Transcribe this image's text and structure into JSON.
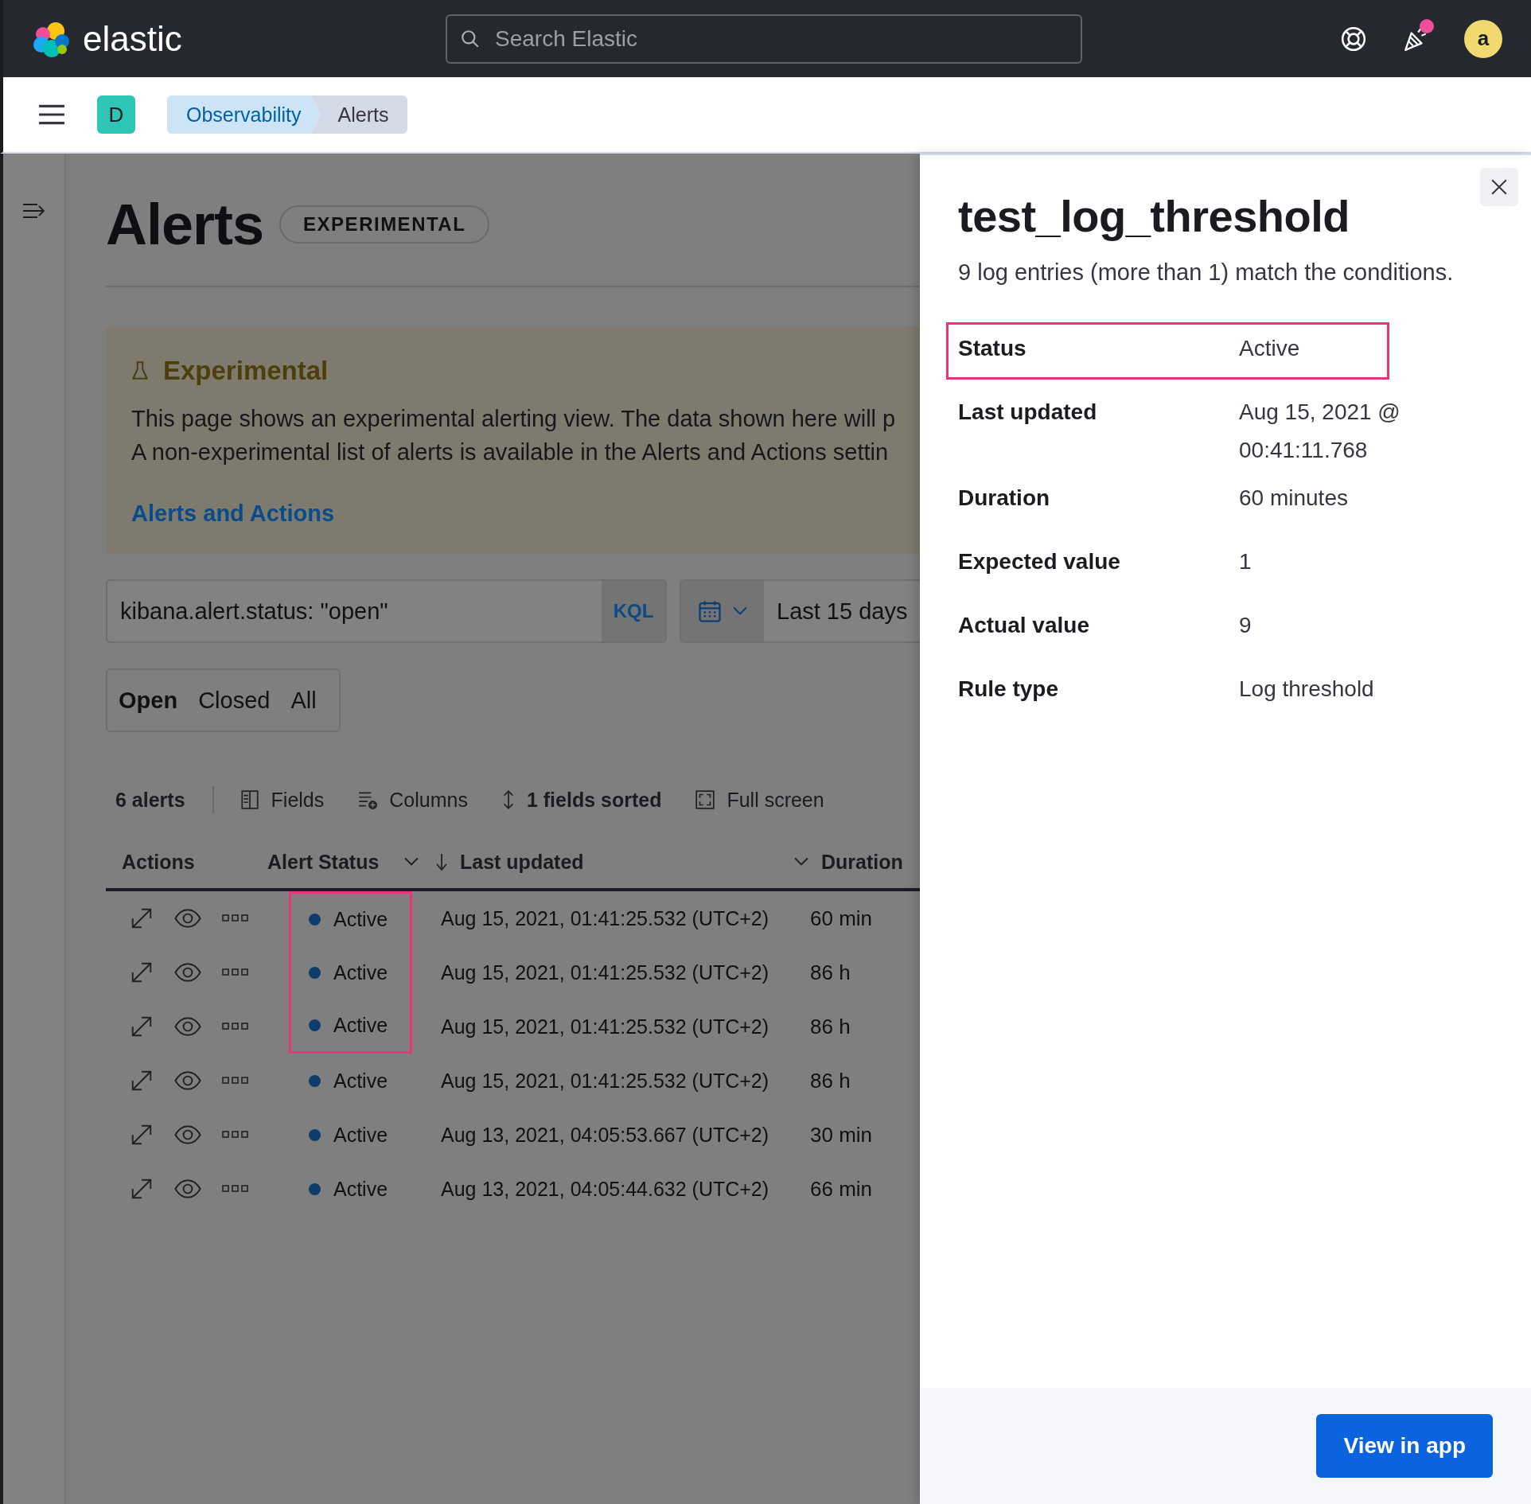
{
  "header": {
    "logo": "elastic",
    "search": {
      "placeholder": "Search Elastic"
    },
    "has_notification": true,
    "avatar": "a"
  },
  "breadcrumb_bar": {
    "space": "D",
    "crumbs": [
      {
        "label": "Observability",
        "selected": false
      },
      {
        "label": "Alerts",
        "selected": true
      }
    ]
  },
  "page": {
    "title": "Alerts",
    "badge": "EXPERIMENTAL",
    "callout": {
      "title": "Experimental",
      "lines": [
        "This page shows an experimental alerting view. The data shown here will p",
        "A non-experimental list of alerts is available in the Alerts and Actions settin"
      ],
      "link": "Alerts and Actions"
    },
    "query": {
      "value": "kibana.alert.status: \"open\"",
      "language": "KQL"
    },
    "date_range": "Last 15 days",
    "status_filters": [
      {
        "label": "Open",
        "selected": true
      },
      {
        "label": "Closed",
        "selected": false
      },
      {
        "label": "All",
        "selected": false
      }
    ],
    "toolbar": {
      "count": "6 alerts",
      "buttons": [
        {
          "kind": "fields",
          "label": "Fields"
        },
        {
          "kind": "columns",
          "label": "Columns"
        },
        {
          "kind": "sort",
          "label": "1 fields sorted"
        },
        {
          "kind": "fullscreen",
          "label": "Full screen"
        }
      ]
    },
    "table": {
      "columns": [
        "Actions",
        "Alert Status",
        "Last updated",
        "Duration"
      ],
      "rows": [
        {
          "status": "Active",
          "last_updated": "Aug 15, 2021, 01:41:25.532 (UTC+2)",
          "duration": "60 min",
          "highlighted": true
        },
        {
          "status": "Active",
          "last_updated": "Aug 15, 2021, 01:41:25.532 (UTC+2)",
          "duration": "86 h",
          "highlighted": true
        },
        {
          "status": "Active",
          "last_updated": "Aug 15, 2021, 01:41:25.532 (UTC+2)",
          "duration": "86 h",
          "highlighted": true
        },
        {
          "status": "Active",
          "last_updated": "Aug 15, 2021, 01:41:25.532 (UTC+2)",
          "duration": "86 h",
          "highlighted": false
        },
        {
          "status": "Active",
          "last_updated": "Aug 13, 2021, 04:05:53.667 (UTC+2)",
          "duration": "30 min",
          "highlighted": false
        },
        {
          "status": "Active",
          "last_updated": "Aug 13, 2021, 04:05:44.632 (UTC+2)",
          "duration": "66 min",
          "highlighted": false
        }
      ]
    }
  },
  "flyout": {
    "title": "test_log_threshold",
    "subtitle": "9 log entries (more than 1) match the conditions.",
    "fields": [
      {
        "label": "Status",
        "value": "Active",
        "highlighted": true
      },
      {
        "label": "Last updated",
        "value": "Aug 15, 2021 @ 00:41:11.768",
        "highlighted": false
      },
      {
        "label": "Duration",
        "value": "60 minutes",
        "highlighted": false
      },
      {
        "label": "Expected value",
        "value": "1",
        "highlighted": false
      },
      {
        "label": "Actual value",
        "value": "9",
        "highlighted": false
      },
      {
        "label": "Rule type",
        "value": "Log threshold",
        "highlighted": false
      }
    ],
    "button": "View in app"
  }
}
